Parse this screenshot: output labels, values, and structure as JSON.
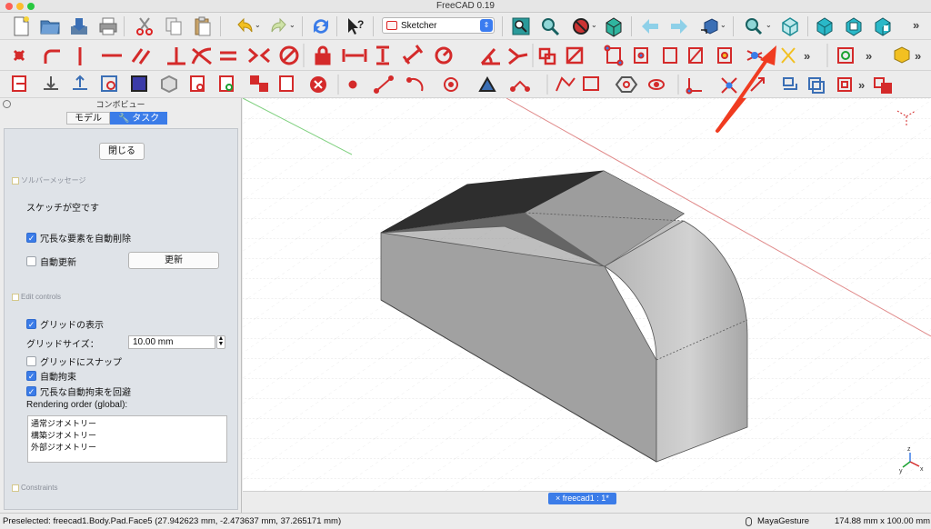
{
  "window": {
    "title": "FreeCAD 0.19"
  },
  "toolbar": {
    "workbench": "Sketcher",
    "overflow": "»"
  },
  "combo": {
    "title": "コンボビュー",
    "tabs": [
      {
        "label": "モデル"
      },
      {
        "label": "タスク"
      }
    ],
    "close_button": "閉じる",
    "solver_section": "ソルバーメッセージ",
    "solver_message": "スケッチが空です",
    "auto_remove_redundants": "冗長な要素を自動削除",
    "auto_update": "自動更新",
    "update_button": "更新",
    "edit_controls_section": "Edit controls",
    "show_grid": "グリッドの表示",
    "grid_size_label": "グリッドサイズ：",
    "grid_size_value": "10.00 mm",
    "grid_snap": "グリッドにスナップ",
    "auto_constraints": "自動拘束",
    "avoid_redundant": "冗長な自動拘束を回避",
    "rendering_order_label": "Rendering order (global):",
    "rendering_order": [
      "通常ジオメトリー",
      "構築ジオメトリー",
      "外部ジオメトリー"
    ],
    "constraints_section": "Constraints"
  },
  "document_tab": {
    "label": "freecad1 : 1*",
    "close": "×"
  },
  "status": {
    "preselected": "Preselected: freecad1.Body.Pad.Face5 (27.942623 mm, -2.473637 mm, 37.265171 mm)",
    "navigation": "MayaGesture",
    "dimensions": "174.88 mm x 100.00 mm"
  },
  "axes": {
    "x": "x",
    "y": "y",
    "z": "z"
  },
  "colors": {
    "accent": "#3b7ce8",
    "arrow": "#f03b20",
    "sketch_red": "#d42a2a",
    "solid_gray": "#9a9a9a",
    "dark_face": "#3e3e3e"
  }
}
